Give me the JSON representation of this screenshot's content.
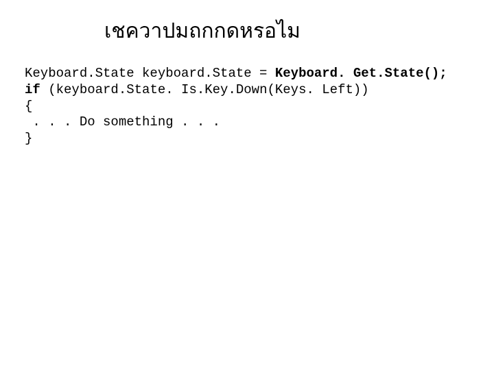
{
  "title": "เชควาปมถกกดหรอไม",
  "code": {
    "line1_part1": "Keyboard.State keyboard.State = ",
    "line1_part2": "Keyboard. Get.State();",
    "line2_part1": "if ",
    "line2_part2": "(keyboard.State. Is.Key.Down(Keys. Left))",
    "line3": "{",
    "line4": " . . . Do something . . .",
    "line5": "}"
  }
}
